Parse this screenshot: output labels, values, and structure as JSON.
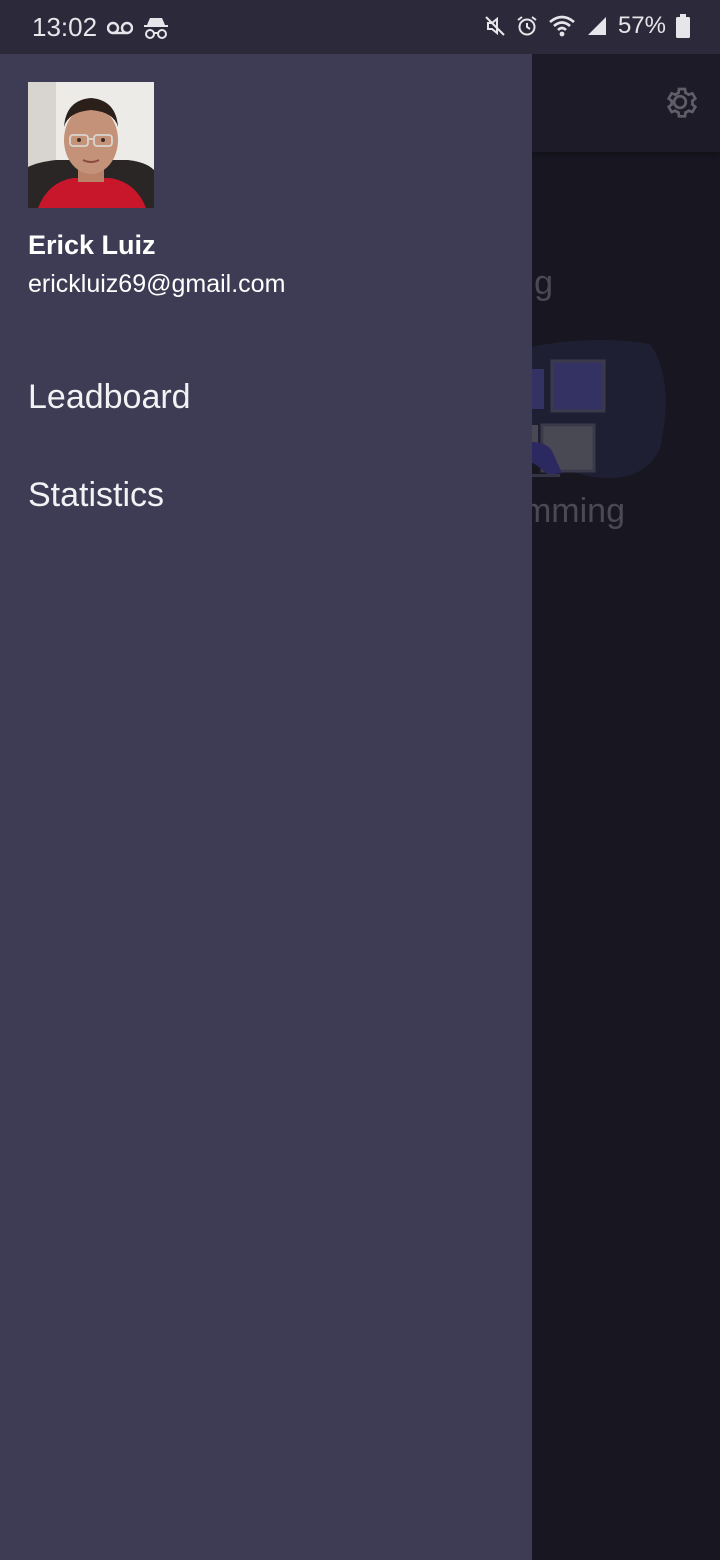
{
  "status_bar": {
    "time": "13:02",
    "battery": "57%",
    "icons": [
      "voicemail-icon",
      "incognito-icon",
      "mute-icon",
      "alarm-icon",
      "wifi-icon",
      "signal-icon",
      "battery-icon"
    ]
  },
  "app": {
    "settings_icon": "gear-icon",
    "partial_text_1": "g",
    "partial_text_2": "mming"
  },
  "drawer": {
    "user": {
      "name": "Erick Luiz",
      "email": "erickluiz69@gmail.com"
    },
    "menu": [
      {
        "label": "Leadboard"
      },
      {
        "label": "Statistics"
      }
    ]
  },
  "colors": {
    "drawer_bg": "#3e3c54",
    "status_bar_bg": "#2c2a3a",
    "app_bg": "#1f1d29",
    "text": "#ffffff"
  }
}
